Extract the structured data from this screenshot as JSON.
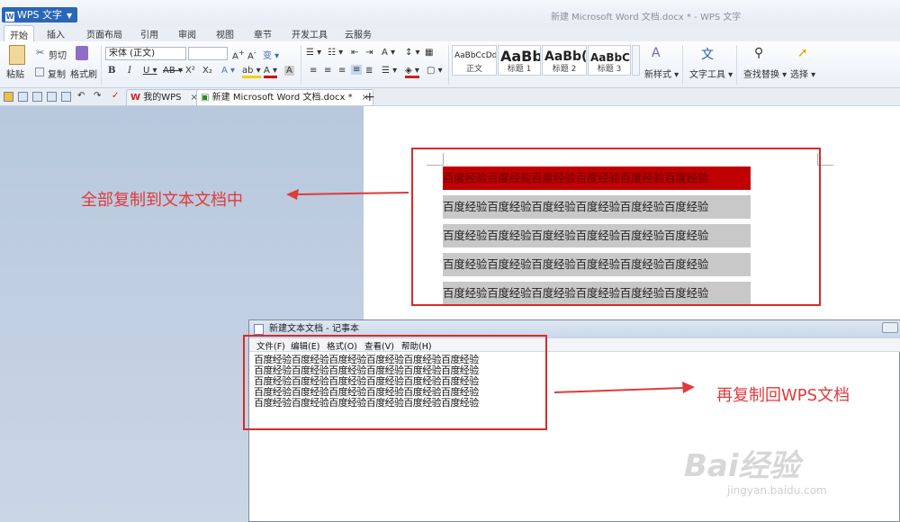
{
  "app": {
    "menu_label": "WPS 文字",
    "window_title": "新建 Microsoft Word 文档.docx * - WPS 文字"
  },
  "tabs": [
    "开始",
    "插入",
    "页面布局",
    "引用",
    "审阅",
    "视图",
    "章节",
    "开发工具",
    "云服务"
  ],
  "ribbon": {
    "paste": "粘贴",
    "cut": "剪切",
    "copy": "复制",
    "format_painter": "格式刷",
    "font_name": "宋体 (正文)",
    "font_size": "",
    "styles": [
      {
        "sample": "AaBbCcDd",
        "label": "正文"
      },
      {
        "sample": "AaBb",
        "label": "标题 1"
      },
      {
        "sample": "AaBb(",
        "label": "标题 2"
      },
      {
        "sample": "AaBbC",
        "label": "标题 3"
      }
    ],
    "new_style": "新样式",
    "text_tools": "文字工具",
    "find_replace": "查找替换",
    "select": "选择"
  },
  "doc_tabs": [
    {
      "label": "我的WPS"
    },
    {
      "label": "新建 Microsoft Word 文档.docx *"
    }
  ],
  "document": {
    "lines": [
      "百度经验百度经验百度经验百度经验百度经验百度经验",
      "百度经验百度经验百度经验百度经验百度经验百度经验",
      "百度经验百度经验百度经验百度经验百度经验百度经验",
      "百度经验百度经验百度经验百度经验百度经验百度经验",
      "百度经验百度经验百度经验百度经验百度经验百度经验"
    ]
  },
  "annotations": {
    "left": "全部复制到文本文档中",
    "right": "再复制回WPS文档"
  },
  "notepad": {
    "title": "新建文本文档 - 记事本",
    "menu": [
      "文件(F)",
      "编辑(E)",
      "格式(O)",
      "查看(V)",
      "帮助(H)"
    ],
    "lines": [
      "百度经验百度经验百度经验百度经验百度经验百度经验",
      "百度经验百度经验百度经验百度经验百度经验百度经验",
      "百度经验百度经验百度经验百度经验百度经验百度经验",
      "百度经验百度经验百度经验百度经验百度经验百度经验",
      "百度经验百度经验百度经验百度经验百度经验百度经验"
    ]
  },
  "watermark": {
    "brand": "Bai经验",
    "url": "jingyan.baidu.com"
  },
  "colors": {
    "annotation_red": "#e03a3a",
    "selection_highlight": "#c00000",
    "brand_blue": "#2a66b8"
  }
}
